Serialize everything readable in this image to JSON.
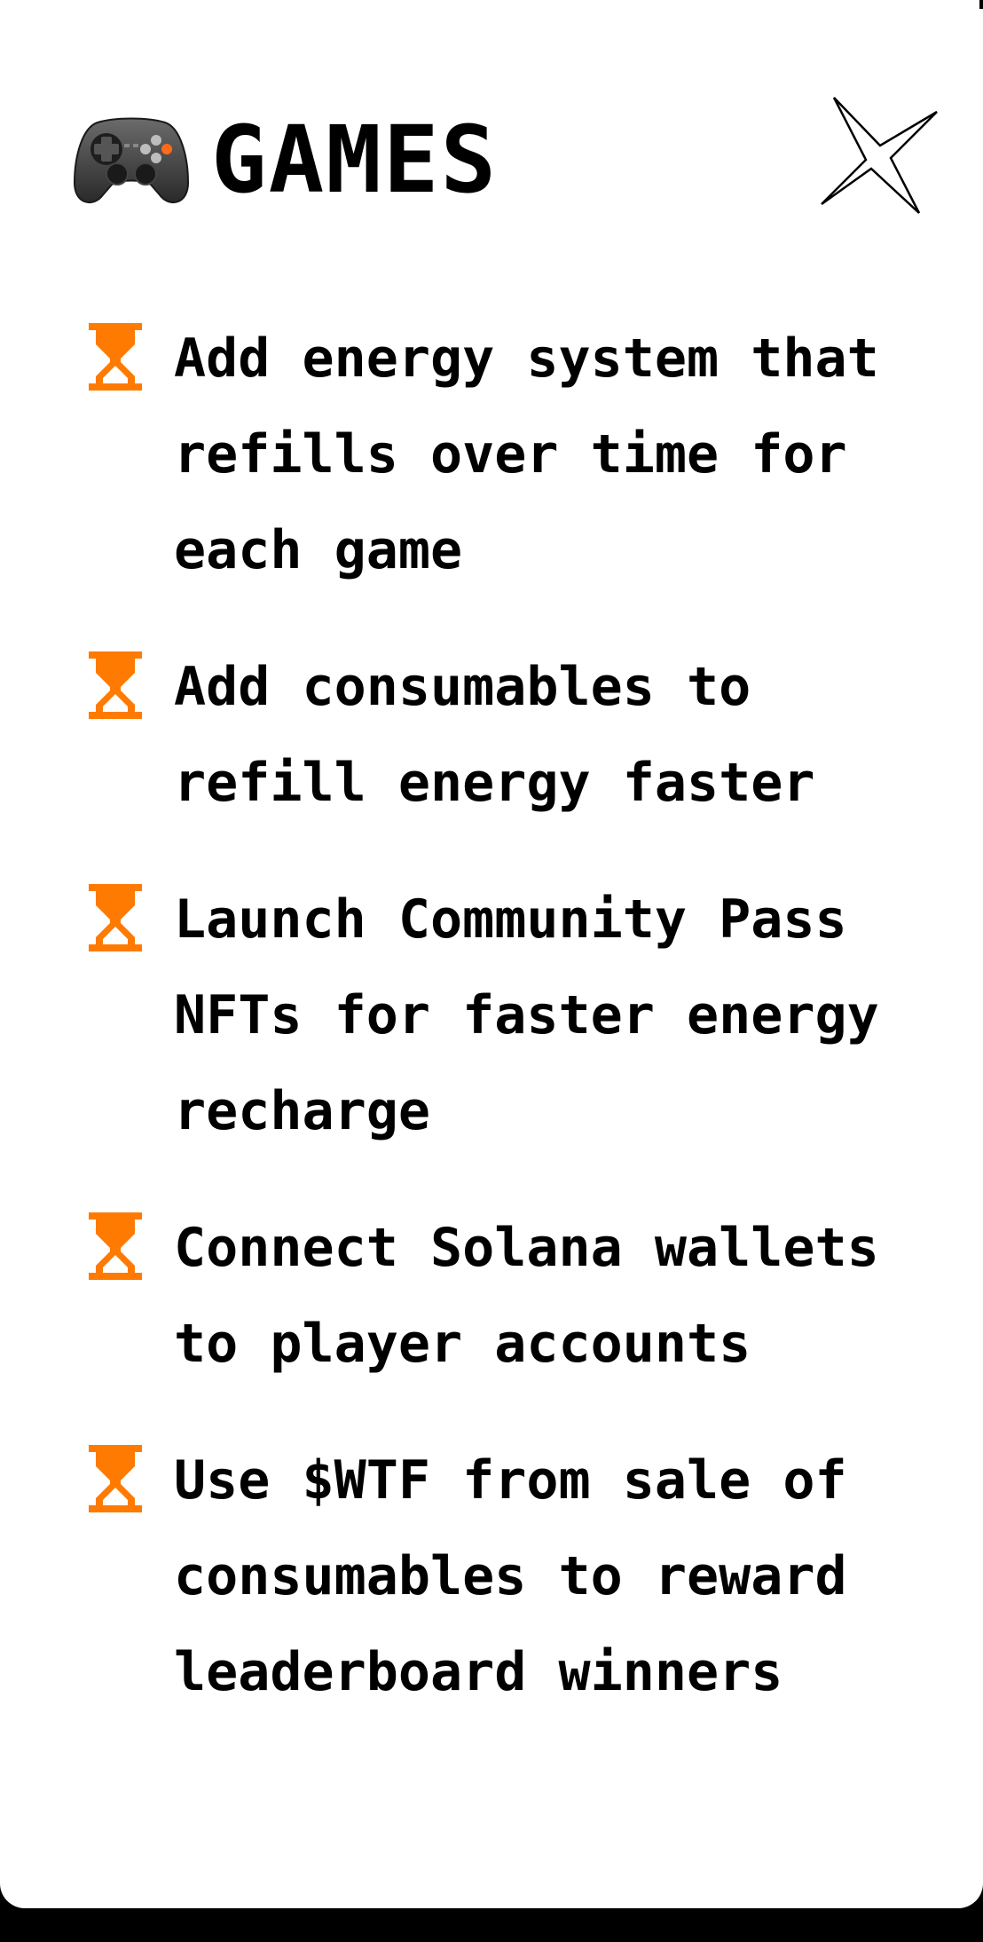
{
  "header": {
    "icon": "gamepad-icon",
    "title": "GAMES",
    "close_icon": "sparkle-close-icon"
  },
  "colors": {
    "accent": "#ff7a00",
    "text": "#000000",
    "card": "#ffffff",
    "background": "#000000"
  },
  "items": [
    {
      "icon": "hourglass-icon",
      "text": "Add energy system that refills over time for each game"
    },
    {
      "icon": "hourglass-icon",
      "text": "Add consumables to refill energy faster"
    },
    {
      "icon": "hourglass-icon",
      "text": "Launch Community Pass NFTs for faster energy recharge"
    },
    {
      "icon": "hourglass-icon",
      "text": "Connect Solana wallets to player accounts"
    },
    {
      "icon": "hourglass-icon",
      "text": "Use $WTF from sale of consumables to reward leaderboard winners"
    }
  ]
}
